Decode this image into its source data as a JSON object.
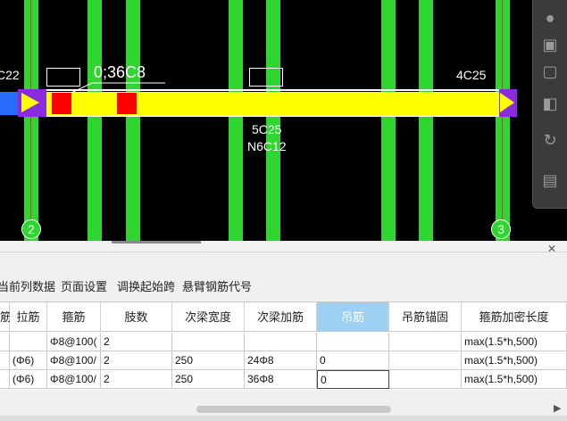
{
  "cad": {
    "annotations": {
      "left_cut": "C22",
      "beam_spec": "0;36C8",
      "right_top": "4C25",
      "mid_bottom_1": "5C25",
      "mid_bottom_2": "N6C12"
    },
    "axis_labels": [
      "2",
      "3"
    ]
  },
  "toolbar": {
    "items": [
      "当前列数据",
      "页面设置",
      "调换起始跨",
      "悬臂钢筋代号"
    ]
  },
  "table": {
    "headers": [
      "筋",
      "拉筋",
      "箍筋",
      "肢数",
      "次梁宽度",
      "次梁加筋",
      "吊筋",
      "吊筋锚固",
      "箍筋加密长度"
    ],
    "selected_header": "吊筋",
    "rows": [
      [
        "",
        "",
        "Φ8@100(",
        "2",
        "",
        "",
        "",
        "",
        "max(1.5*h,500)"
      ],
      [
        "",
        "(Φ6)",
        "Φ8@100/",
        "2",
        "250",
        "24Φ8",
        "0",
        "",
        "max(1.5*h,500)"
      ],
      [
        "",
        "(Φ6)",
        "Φ8@100/",
        "2",
        "250",
        "36Φ8",
        "0",
        "",
        "max(1.5*h,500)"
      ]
    ]
  },
  "colors": {
    "column_green": "#2fd62f",
    "beam_yellow": "#ffff00",
    "support_purple": "#8a2be2",
    "header_selected": "#9ed0f4"
  }
}
